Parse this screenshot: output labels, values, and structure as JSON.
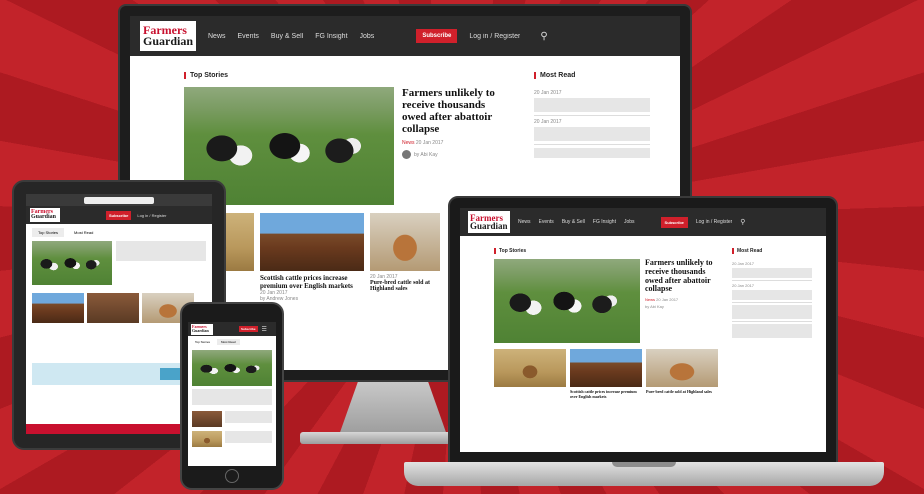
{
  "site": {
    "logo_line1": "Farmers",
    "logo_line2": "Guardian",
    "nav": [
      "News",
      "Events",
      "Buy & Sell",
      "FG Insight",
      "Jobs"
    ],
    "subscribe": "Subscribe",
    "login": "Log in / Register"
  },
  "sections": {
    "top_stories": "Top Stories",
    "most_read": "Most Read"
  },
  "lead_story": {
    "headline": "Farmers unlikely to receive thousands owed after abattoir collapse",
    "tag": "News",
    "date": "20 Jan 2017",
    "author": "by Abi Kay",
    "excerpt": ""
  },
  "secondary_stories": [
    {
      "headline": "",
      "tag": "",
      "date": ""
    },
    {
      "headline": "Scottish cattle prices increase premium over English markets",
      "tag": "",
      "date": "20 Jan 2017",
      "author": "by Andrew Jones"
    },
    {
      "headline": "Pure-bred cattle sold at Highland sales",
      "tag": "",
      "date": "20 Jan 2017"
    }
  ],
  "most_read": [
    {
      "date": "20 Jan 2017",
      "headline": "",
      "tag": ""
    },
    {
      "date": "20 Jan 2017",
      "headline": "",
      "tag": ""
    },
    {
      "date": "",
      "headline": "",
      "tag": ""
    }
  ],
  "tablet": {
    "url": "",
    "tabs": [
      "Top Stories",
      "Most Read"
    ],
    "headline": "",
    "banner_text": ""
  },
  "phone": {
    "tabs": [
      "Top Stories",
      "Most Read"
    ]
  },
  "colors": {
    "brand_red": "#d0202b",
    "nav_dark": "#2b2b2b",
    "background": "#b81d24"
  }
}
